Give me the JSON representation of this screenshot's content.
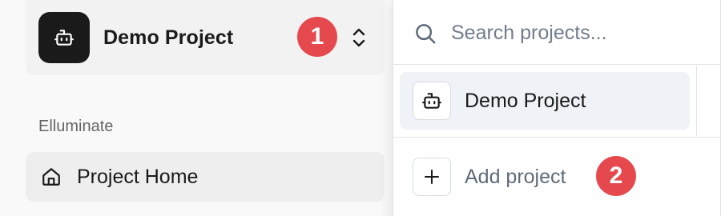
{
  "sidebar": {
    "project_switcher": {
      "project_name": "Demo Project",
      "avatar_icon": "robot-icon",
      "toggle_icon": "chevron-up-down-icon"
    },
    "section_label": "Elluminate",
    "nav_items": [
      {
        "label": "Project Home",
        "icon": "home-icon"
      }
    ]
  },
  "dropdown": {
    "search": {
      "placeholder": "Search projects...",
      "value": "",
      "icon": "search-icon"
    },
    "projects": [
      {
        "label": "Demo Project",
        "icon": "robot-icon",
        "selected": true
      }
    ],
    "add_project_label": "Add project",
    "add_icon": "plus-icon"
  },
  "callouts": {
    "step_1": "1",
    "step_2": "2"
  },
  "colors": {
    "badge": "#e5484d",
    "avatar_bg": "#1a1a1a",
    "selected_item_bg": "#eff2f7"
  }
}
